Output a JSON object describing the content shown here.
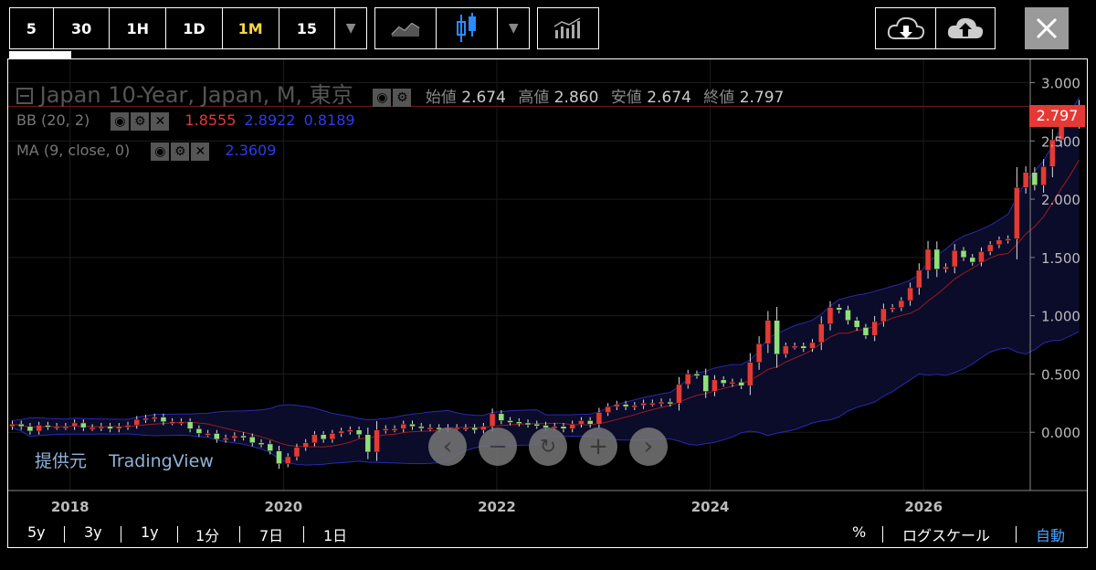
{
  "toolbar": {
    "intervals": [
      "5",
      "30",
      "1H",
      "1D",
      "1M",
      "15"
    ],
    "active_interval": "1M"
  },
  "legend": {
    "title": "Japan 10-Year, Japan, M, 東京",
    "open_label": "始値",
    "open": "2.674",
    "high_label": "高値",
    "high": "2.860",
    "low_label": "安値",
    "low": "2.674",
    "close_label": "終値",
    "close": "2.797",
    "bb_label": "BB (20, 2)",
    "bb_mid": "1.8555",
    "bb_upper": "2.8922",
    "bb_lower": "0.8189",
    "ma_label": "MA (9, close, 0)",
    "ma_value": "2.3609"
  },
  "attribution": {
    "label": "提供元",
    "source": "TradingView"
  },
  "bottom": {
    "ranges": [
      "5y",
      "3y",
      "1y",
      "1分",
      "7日",
      "1日"
    ],
    "percent": "%",
    "log_scale": "ログスケール",
    "auto": "自動"
  },
  "colors": {
    "up": "#8fe07a",
    "down": "#e53935",
    "bb": "#2a2ab0",
    "ma": "#9b1c1c",
    "band_fill": "#0b0b2a"
  },
  "chart_data": {
    "type": "candlestick",
    "title": "Japan 10-Year, Japan, M, 東京",
    "yticks": [
      0.0,
      0.5,
      1.0,
      1.5,
      2.0,
      2.5,
      3.0
    ],
    "ytick_labels": [
      "0.000",
      "0.500",
      "1.000",
      "1.500",
      "2.000",
      "2.500",
      "3.000"
    ],
    "ylim": [
      -0.5,
      3.2
    ],
    "xticks": [
      2018,
      2020,
      2022,
      2024,
      2026
    ],
    "xlim": [
      2017.42,
      2027.0
    ],
    "last_price": "2.797",
    "series": [
      {
        "name": "Japan 10-Year",
        "kind": "ohlc_monthly",
        "start": "2017-06",
        "close": [
          0.07,
          0.05,
          0.01,
          0.06,
          0.05,
          0.05,
          0.05,
          0.08,
          0.04,
          0.04,
          0.05,
          0.03,
          0.05,
          0.06,
          0.11,
          0.12,
          0.13,
          0.09,
          0.09,
          0.09,
          0.03,
          -0.01,
          -0.01,
          -0.06,
          -0.05,
          -0.03,
          -0.04,
          -0.09,
          -0.1,
          -0.16,
          -0.27,
          -0.21,
          -0.13,
          -0.09,
          -0.02,
          -0.06,
          -0.01,
          0.01,
          0.02,
          -0.02,
          -0.17,
          0.02,
          0.03,
          0.03,
          0.07,
          0.05,
          0.04,
          0.04,
          0.03,
          0.04,
          0.04,
          0.04,
          0.02,
          0.05,
          0.16,
          0.1,
          0.09,
          0.08,
          0.07,
          0.06,
          0.04,
          0.05,
          0.03,
          0.07,
          0.1,
          0.07,
          0.17,
          0.22,
          0.24,
          0.22,
          0.23,
          0.25,
          0.25,
          0.26,
          0.25,
          0.41,
          0.5,
          0.49,
          0.35,
          0.45,
          0.42,
          0.43,
          0.4,
          0.6,
          0.76,
          0.96,
          0.67,
          0.74,
          0.74,
          0.72,
          0.77,
          0.93,
          1.07,
          1.05,
          0.96,
          0.9,
          0.83,
          0.95,
          1.06,
          1.07,
          1.13,
          1.24,
          1.39,
          1.57,
          1.4,
          1.42,
          1.56,
          1.5,
          1.46,
          1.55,
          1.61,
          1.65,
          1.66,
          2.1,
          2.23,
          2.12,
          2.28,
          2.51,
          2.67,
          2.66,
          2.797
        ]
      }
    ],
    "bollinger": {
      "period": 20,
      "mult": 2,
      "upper": "2.8922",
      "middle": "1.8555",
      "lower": "0.8189"
    },
    "moving_average": {
      "period": 9,
      "value": "2.3609"
    }
  }
}
